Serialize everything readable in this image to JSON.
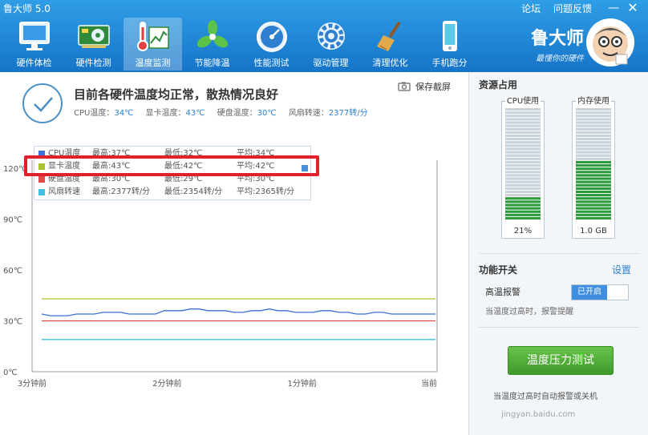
{
  "window": {
    "title": "鲁大师 5.0",
    "links": [
      "论坛",
      "问题反馈"
    ],
    "minimize_label": "—",
    "close_label": "✕"
  },
  "nav": {
    "items": [
      {
        "label": "硬件体检",
        "icon": "monitor-icon",
        "active": false
      },
      {
        "label": "硬件检测",
        "icon": "hardware-card-icon",
        "active": false
      },
      {
        "label": "温度监测",
        "icon": "thermometer-chart-icon",
        "active": true
      },
      {
        "label": "节能降温",
        "icon": "fan-icon",
        "active": false
      },
      {
        "label": "性能测试",
        "icon": "speedometer-icon",
        "active": false
      },
      {
        "label": "驱动管理",
        "icon": "gear-icon",
        "active": false
      },
      {
        "label": "清理优化",
        "icon": "broom-icon",
        "active": false
      },
      {
        "label": "手机跑分",
        "icon": "phone-icon",
        "active": false
      }
    ]
  },
  "brand": {
    "name": "鲁大师",
    "slogan": "最懂你的硬件"
  },
  "status": {
    "title": "目前各硬件温度均正常，散热情况良好",
    "items": [
      {
        "label": "CPU温度：",
        "value": "34℃"
      },
      {
        "label": "显卡温度：",
        "value": "43℃"
      },
      {
        "label": "硬盘温度：",
        "value": "30℃"
      },
      {
        "label": "风扇转速：",
        "value": "2377转/分"
      }
    ],
    "screenshot_label": "保存截屏"
  },
  "legend": [
    {
      "name": "CPU温度",
      "max": "最高:37℃",
      "min": "最低:32℃",
      "avg": "平均:34℃",
      "color": "#3a6fd8"
    },
    {
      "name": "显卡温度",
      "max": "最高:43℃",
      "min": "最低:42℃",
      "avg": "平均:42℃",
      "color": "#a8c42a"
    },
    {
      "name": "硬盘温度",
      "max": "最高:30℃",
      "min": "最低:29℃",
      "avg": "平均:30℃",
      "color": "#e04a4a"
    },
    {
      "name": "风扇转速",
      "max": "最高:2377转/分",
      "min": "最低:2354转/分",
      "avg": "平均:2365转/分",
      "color": "#3fc0e0"
    }
  ],
  "chart_data": {
    "type": "line",
    "y_ticks": [
      "120℃",
      "90℃",
      "60℃",
      "30℃",
      "0℃"
    ],
    "y_tick_values": [
      120,
      90,
      60,
      30,
      0
    ],
    "ylim": [
      0,
      120
    ],
    "x_ticks": [
      "3分钟前",
      "2分钟前",
      "1分钟前",
      "当前"
    ],
    "grid": false,
    "series": [
      {
        "name": "CPU温度",
        "color": "#3a6fd8",
        "values": [
          34,
          33,
          33,
          33,
          34,
          34,
          34,
          35,
          35,
          35,
          34,
          34,
          34,
          34,
          36,
          36,
          36,
          37,
          37,
          36,
          36,
          36,
          35,
          35,
          36,
          36,
          37,
          36,
          36,
          35,
          35,
          35,
          36,
          36,
          35,
          35,
          34,
          34,
          35,
          35,
          34,
          34,
          34,
          34,
          34,
          34
        ]
      },
      {
        "name": "显卡温度",
        "color": "#a8c42a",
        "values": [
          43,
          43,
          43,
          43,
          43,
          43,
          43,
          43,
          43,
          43,
          43,
          43,
          43,
          43,
          43,
          43,
          43,
          43,
          43,
          43,
          43,
          43,
          43,
          43,
          43,
          43,
          43,
          43,
          43,
          43,
          43,
          43,
          43,
          43,
          43,
          43,
          43,
          43,
          43,
          43,
          43,
          43,
          43,
          43,
          43,
          43
        ]
      },
      {
        "name": "硬盘温度",
        "color": "#e04a4a",
        "values": [
          30,
          30,
          30,
          30,
          30,
          30,
          30,
          30,
          30,
          30,
          30,
          30,
          30,
          30,
          30,
          30,
          30,
          30,
          30,
          30,
          30,
          30,
          30,
          30,
          30,
          30,
          30,
          30,
          30,
          30,
          30,
          30,
          30,
          30,
          30,
          30,
          30,
          30,
          30,
          30,
          30,
          30,
          30,
          30,
          30,
          30
        ]
      },
      {
        "name": "风扇转速",
        "color": "#3fc0e0",
        "values": [
          19,
          19,
          19,
          19,
          19,
          19,
          19,
          19,
          19,
          19,
          19,
          19,
          19,
          19,
          19,
          19,
          19,
          19,
          19,
          19,
          19,
          19,
          19,
          19,
          19,
          19,
          19,
          19,
          19,
          19,
          19,
          19,
          19,
          19,
          19,
          19,
          19,
          19,
          19,
          19,
          19,
          19,
          19,
          19,
          19,
          19
        ]
      }
    ]
  },
  "resources": {
    "title": "资源占用",
    "cpu": {
      "label": "CPU使用",
      "value": "21%",
      "fill": 0.21,
      "color": "#2e9a3c"
    },
    "memory": {
      "label": "内存使用",
      "value": "1.0 GB",
      "fill": 0.52,
      "color": "#2e9a3c"
    }
  },
  "functions": {
    "title": "功能开关",
    "settings_label": "设置",
    "alarm_label": "高温报警",
    "alarm_state": "已开启",
    "alarm_desc": "当温度过高时，报警提醒",
    "stress_button": "温度压力测试",
    "bottom_note": "当温度过高时自动报警或关机",
    "watermark": "jingyan.baidu.com"
  }
}
